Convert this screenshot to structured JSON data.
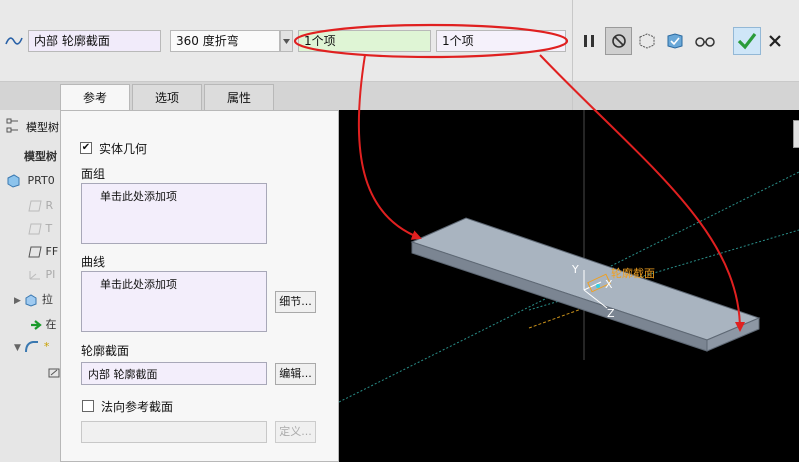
{
  "toolbar": {
    "sketch_field": "内部 轮廓截面",
    "bend_type": "360 度折弯",
    "ref1_value": "1个项",
    "ref2_value": "1个项",
    "icons": [
      "sketch-icon",
      "dropdown-icon",
      "pause-icon",
      "no-preview-icon",
      "geometry-preview-icon",
      "verify-icon",
      "glasses-icon",
      "ok-check-icon",
      "cancel-x-icon"
    ],
    "colors": {
      "ok": "#2a9b3a",
      "highlight_ellipse": "#e02020",
      "bg": "#e9e9e9"
    }
  },
  "tabs": [
    "参考",
    "选项",
    "属性"
  ],
  "panel": {
    "solid_geometry_label": "实体几何",
    "solid_geometry_checked": true,
    "quilt_label": "面组",
    "quilt_placeholder": "单击此处添加项",
    "curves_label": "曲线",
    "curves_placeholder": "单击此处添加项",
    "details_button": "细节...",
    "profile_section_label": "轮廓截面",
    "profile_section_value": "内部 轮廓截面",
    "edit_button": "编辑...",
    "normal_ref_label": "法向参考截面",
    "normal_ref_checked": false,
    "define_button": "定义..."
  },
  "tree": {
    "header_label": "模型树",
    "header2_label": "模型树",
    "items": [
      "PRT0",
      "R",
      "T",
      "FF",
      "PI",
      "拉",
      "在",
      "*"
    ]
  },
  "viewport": {
    "axis_y": "Y",
    "axis_x": "X",
    "axis_z": "Z",
    "section_label": "轮廓截面",
    "colors": {
      "background": "#000000",
      "plate_top": "#a9b4c0",
      "plate_side": "#7b8592",
      "datum": "#2a8f8a",
      "annotation": "#f0a020"
    }
  }
}
